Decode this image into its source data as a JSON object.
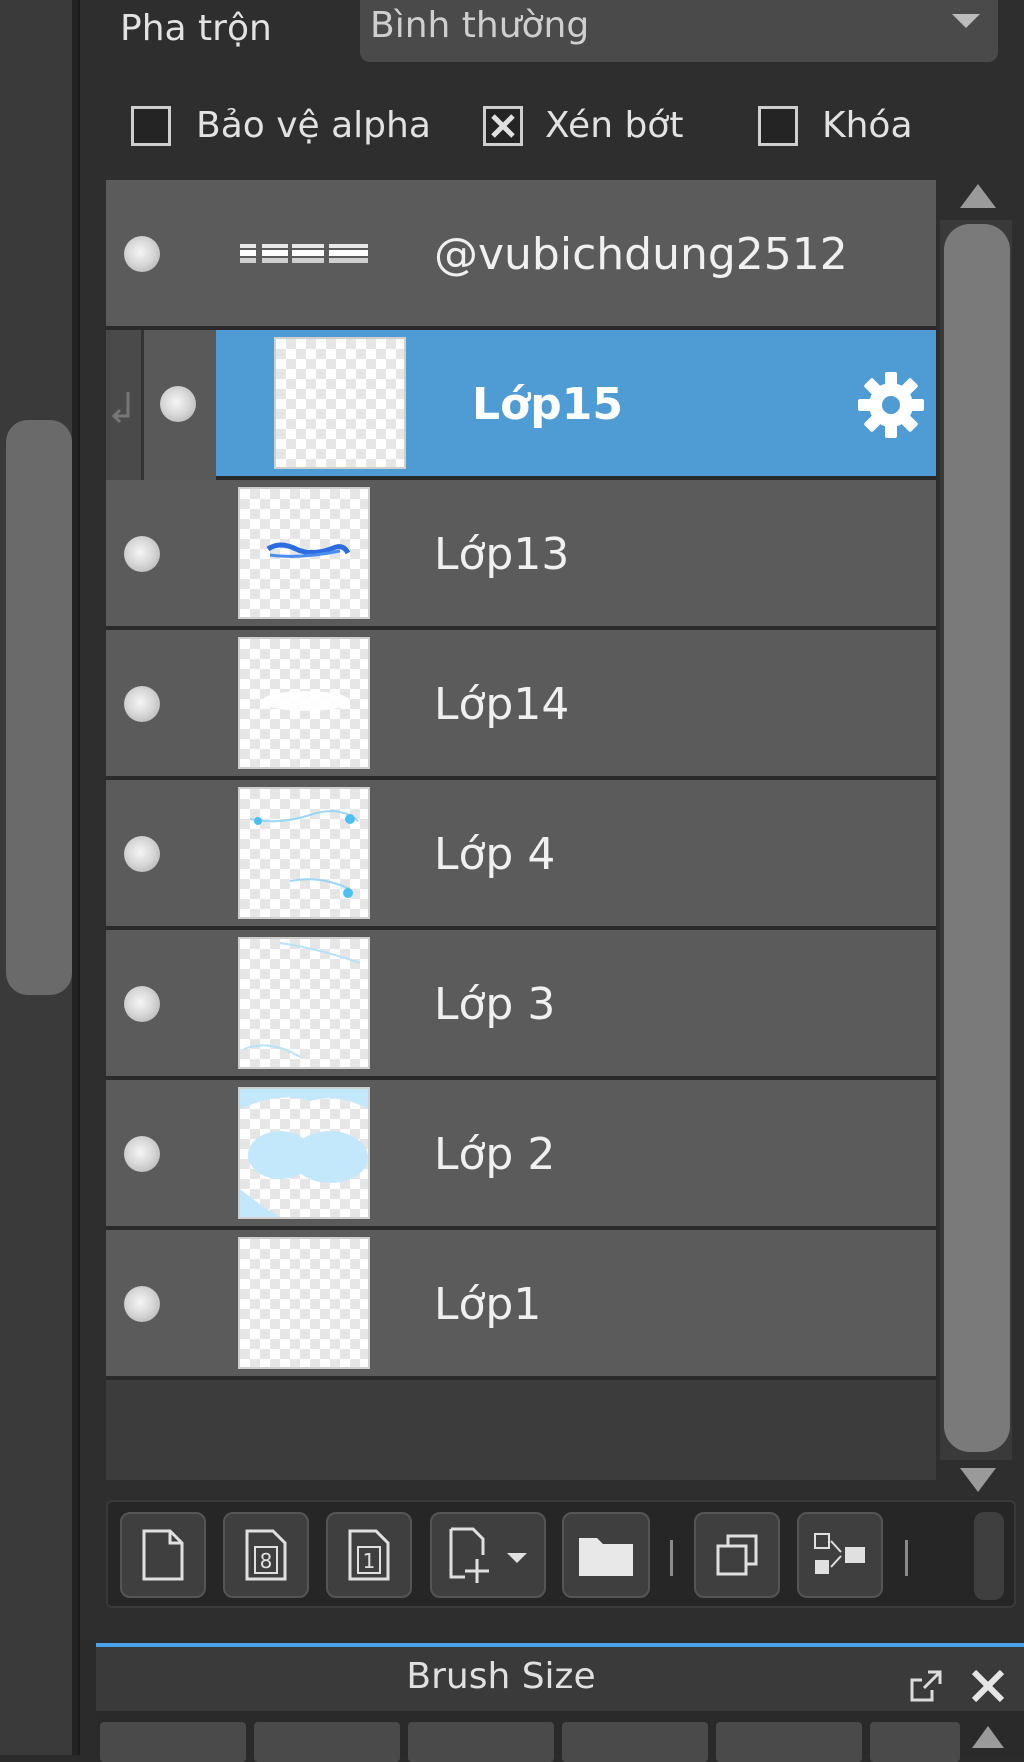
{
  "blend": {
    "label": "Pha trộn",
    "value": "Bình thường"
  },
  "options": {
    "alpha_protect": {
      "label": "Bảo vệ alpha",
      "checked": false
    },
    "clipping": {
      "label": "Xén bớt",
      "checked": true
    },
    "lock": {
      "label": "Khóa",
      "checked": false
    }
  },
  "layers": [
    {
      "name": "@vubichdung2512",
      "visible": true,
      "selected": false
    },
    {
      "name": "Lớp15",
      "visible": true,
      "selected": true,
      "clipped": true
    },
    {
      "name": "Lớp13",
      "visible": true,
      "selected": false
    },
    {
      "name": "Lớp14",
      "visible": true,
      "selected": false
    },
    {
      "name": "Lớp 4",
      "visible": true,
      "selected": false
    },
    {
      "name": "Lớp 3",
      "visible": true,
      "selected": false
    },
    {
      "name": "Lớp 2",
      "visible": true,
      "selected": false
    },
    {
      "name": "Lớp1",
      "visible": true,
      "selected": false
    }
  ],
  "toolbar": {
    "buttons": [
      "new-layer-icon",
      "8bit-layer-icon",
      "1bit-layer-icon",
      "add-layer-dropdown-icon",
      "folder-icon",
      "duplicate-icon",
      "merge-icon"
    ]
  },
  "brush_panel": {
    "title": "Brush Size"
  },
  "colors": {
    "selected_row": "#4f9bd3",
    "panel_accent": "#4aa3e6"
  }
}
